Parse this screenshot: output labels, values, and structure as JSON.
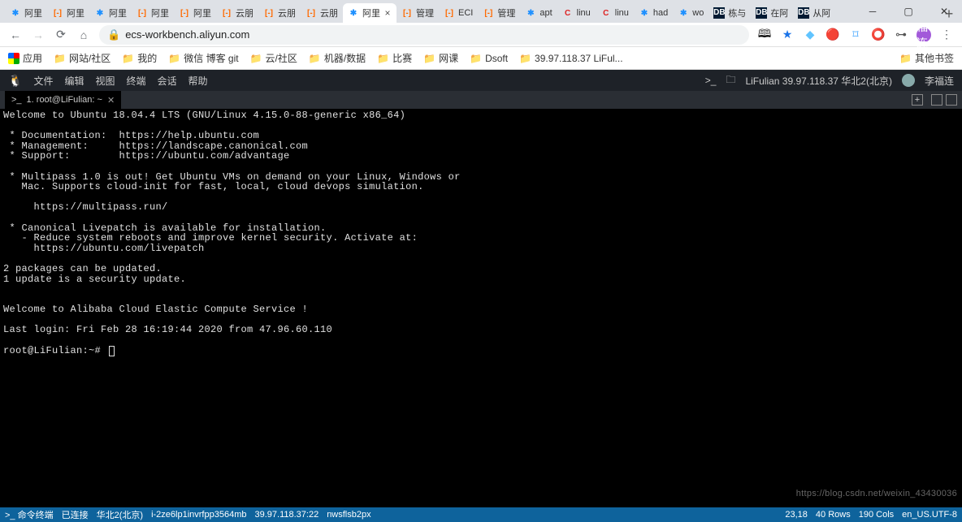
{
  "tabs": [
    {
      "favClass": "fav-blue",
      "favText": "✱",
      "label": "阿里"
    },
    {
      "favClass": "fav-orange",
      "favText": "[-]",
      "label": "阿里"
    },
    {
      "favClass": "fav-blue",
      "favText": "✱",
      "label": "阿里"
    },
    {
      "favClass": "fav-orange",
      "favText": "[-]",
      "label": "阿里"
    },
    {
      "favClass": "fav-orange",
      "favText": "[-]",
      "label": "阿里"
    },
    {
      "favClass": "fav-orange",
      "favText": "[-]",
      "label": "云朋"
    },
    {
      "favClass": "fav-orange",
      "favText": "[-]",
      "label": "云朋"
    },
    {
      "favClass": "fav-orange",
      "favText": "[-]",
      "label": "云朋"
    },
    {
      "favClass": "fav-blue",
      "favText": "✱",
      "label": "阿里",
      "active": true,
      "close": "×"
    },
    {
      "favClass": "fav-orange",
      "favText": "[-]",
      "label": "管理"
    },
    {
      "favClass": "fav-orange",
      "favText": "[-]",
      "label": "ECI"
    },
    {
      "favClass": "fav-orange",
      "favText": "[-]",
      "label": "管理"
    },
    {
      "favClass": "fav-blue",
      "favText": "✱",
      "label": "apt"
    },
    {
      "favClass": "fav-red",
      "favText": "C",
      "label": "linu"
    },
    {
      "favClass": "fav-red",
      "favText": "C",
      "label": "linu"
    },
    {
      "favClass": "fav-blue",
      "favText": "✱",
      "label": "had"
    },
    {
      "favClass": "fav-blue",
      "favText": "✱",
      "label": "wo"
    },
    {
      "favClass": "fav-db",
      "favText": "DB",
      "label": "栋与"
    },
    {
      "favClass": "fav-db",
      "favText": "DB",
      "label": "在阿"
    },
    {
      "favClass": "fav-db",
      "favText": "DB",
      "label": "从阿"
    }
  ],
  "addrbar": {
    "url": "ecs-workbench.aliyun.com"
  },
  "bookmarks": {
    "apps": "应用",
    "items": [
      "网站/社区",
      "我的",
      "微信 博客 git",
      "云/社区",
      "机器/数据",
      "比赛",
      "网课",
      "Dsoft",
      "39.97.118.37 LiFul..."
    ],
    "right": "其他书签"
  },
  "appbar": {
    "menus": [
      "文件",
      "编辑",
      "视图",
      "终端",
      "会话",
      "帮助"
    ],
    "rightText": "LiFulian 39.97.118.37 华北2(北京)",
    "user": "李福连"
  },
  "termtab": {
    "prefix": ">_",
    "label": "1. root@LiFulian: ~",
    "close": "✕"
  },
  "terminal": {
    "lines": [
      "Welcome to Ubuntu 18.04.4 LTS (GNU/Linux 4.15.0-88-generic x86_64)",
      "",
      " * Documentation:  https://help.ubuntu.com",
      " * Management:     https://landscape.canonical.com",
      " * Support:        https://ubuntu.com/advantage",
      "",
      " * Multipass 1.0 is out! Get Ubuntu VMs on demand on your Linux, Windows or",
      "   Mac. Supports cloud-init for fast, local, cloud devops simulation.",
      "",
      "     https://multipass.run/",
      "",
      " * Canonical Livepatch is available for installation.",
      "   - Reduce system reboots and improve kernel security. Activate at:",
      "     https://ubuntu.com/livepatch",
      "",
      "2 packages can be updated.",
      "1 update is a security update.",
      "",
      "",
      "Welcome to Alibaba Cloud Elastic Compute Service !",
      "",
      "Last login: Fri Feb 28 16:19:44 2020 from 47.96.60.110"
    ],
    "prompt": "root@LiFulian:~# ",
    "watermark": "https://blog.csdn.net/weixin_43430036"
  },
  "status": {
    "left": [
      ">_ 命令终端",
      "已连接",
      "华北2(北京)",
      "i-2ze6lp1invrfpp3564mb",
      "39.97.118.37:22",
      "nwsflsb2px"
    ],
    "right": [
      "23,18",
      "40 Rows",
      "190 Cols",
      "en_US.UTF-8"
    ]
  },
  "extAvatar": "福连"
}
